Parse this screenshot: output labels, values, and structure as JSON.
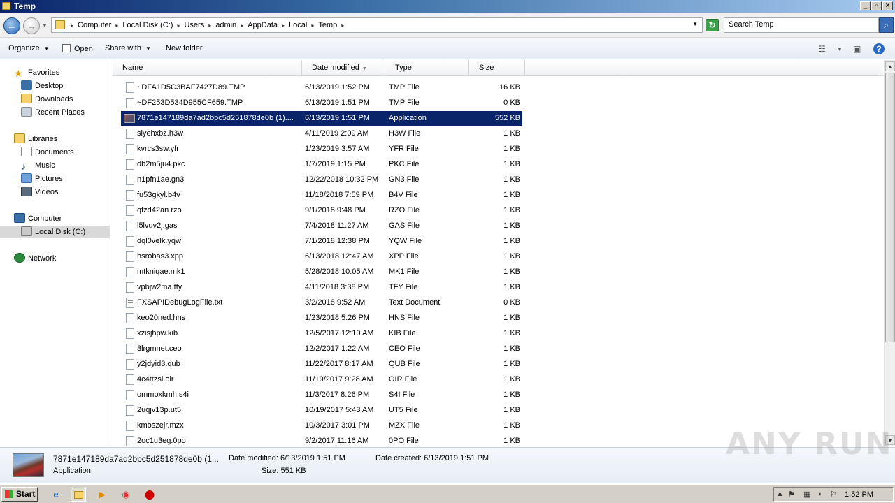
{
  "window": {
    "title": "Temp"
  },
  "address": {
    "crumbs": [
      "Computer",
      "Local Disk (C:)",
      "Users",
      "admin",
      "AppData",
      "Local",
      "Temp"
    ],
    "search_placeholder": "Search Temp"
  },
  "toolbar": {
    "organize": "Organize",
    "open": "Open",
    "share_with": "Share with",
    "new_folder": "New folder"
  },
  "nav": {
    "favorites": "Favorites",
    "desktop": "Desktop",
    "downloads": "Downloads",
    "recent_places": "Recent Places",
    "libraries": "Libraries",
    "documents": "Documents",
    "music": "Music",
    "pictures": "Pictures",
    "videos": "Videos",
    "computer": "Computer",
    "local_disk": "Local Disk (C:)",
    "network": "Network"
  },
  "columns": {
    "name": "Name",
    "date": "Date modified",
    "type": "Type",
    "size": "Size"
  },
  "files": [
    {
      "name": "~DFA1D5C3BAF7427D89.TMP",
      "date": "6/13/2019 1:52 PM",
      "type": "TMP File",
      "size": "16 KB"
    },
    {
      "name": "~DF253D534D955CF659.TMP",
      "date": "6/13/2019 1:51 PM",
      "type": "TMP File",
      "size": "0 KB"
    },
    {
      "name": "7871e147189da7ad2bbc5d251878de0b (1)....",
      "date": "6/13/2019 1:51 PM",
      "type": "Application",
      "size": "552 KB"
    },
    {
      "name": "siyehxbz.h3w",
      "date": "4/11/2019 2:09 AM",
      "type": "H3W File",
      "size": "1 KB"
    },
    {
      "name": "kvrcs3sw.yfr",
      "date": "1/23/2019 3:57 AM",
      "type": "YFR File",
      "size": "1 KB"
    },
    {
      "name": "db2m5ju4.pkc",
      "date": "1/7/2019 1:15 PM",
      "type": "PKC File",
      "size": "1 KB"
    },
    {
      "name": "n1pfn1ae.gn3",
      "date": "12/22/2018 10:32 PM",
      "type": "GN3 File",
      "size": "1 KB"
    },
    {
      "name": "fu53gkyl.b4v",
      "date": "11/18/2018 7:59 PM",
      "type": "B4V File",
      "size": "1 KB"
    },
    {
      "name": "qfzd42an.rzo",
      "date": "9/1/2018 9:48 PM",
      "type": "RZO File",
      "size": "1 KB"
    },
    {
      "name": "l5lvuv2j.gas",
      "date": "7/4/2018 11:27 AM",
      "type": "GAS File",
      "size": "1 KB"
    },
    {
      "name": "dql0velk.yqw",
      "date": "7/1/2018 12:38 PM",
      "type": "YQW File",
      "size": "1 KB"
    },
    {
      "name": "hsrobas3.xpp",
      "date": "6/13/2018 12:47 AM",
      "type": "XPP File",
      "size": "1 KB"
    },
    {
      "name": "mtkniqae.mk1",
      "date": "5/28/2018 10:05 AM",
      "type": "MK1 File",
      "size": "1 KB"
    },
    {
      "name": "vpbjw2ma.tfy",
      "date": "4/11/2018 3:38 PM",
      "type": "TFY File",
      "size": "1 KB"
    },
    {
      "name": "FXSAPIDebugLogFile.txt",
      "date": "3/2/2018 9:52 AM",
      "type": "Text Document",
      "size": "0 KB"
    },
    {
      "name": "keo20ned.hns",
      "date": "1/23/2018 5:26 PM",
      "type": "HNS File",
      "size": "1 KB"
    },
    {
      "name": "xzisjhpw.kib",
      "date": "12/5/2017 12:10 AM",
      "type": "KIB File",
      "size": "1 KB"
    },
    {
      "name": "3lrgmnet.ceo",
      "date": "12/2/2017 1:22 AM",
      "type": "CEO File",
      "size": "1 KB"
    },
    {
      "name": "y2jdyid3.qub",
      "date": "11/22/2017 8:17 AM",
      "type": "QUB File",
      "size": "1 KB"
    },
    {
      "name": "4c4ttzsi.oir",
      "date": "11/19/2017 9:28 AM",
      "type": "OIR File",
      "size": "1 KB"
    },
    {
      "name": "ommoxkmh.s4i",
      "date": "11/3/2017 8:26 PM",
      "type": "S4I File",
      "size": "1 KB"
    },
    {
      "name": "2uqjv13p.ut5",
      "date": "10/19/2017 5:43 AM",
      "type": "UT5 File",
      "size": "1 KB"
    },
    {
      "name": "kmoszejr.mzx",
      "date": "10/3/2017 3:01 PM",
      "type": "MZX File",
      "size": "1 KB"
    },
    {
      "name": "2oc1u3eg.0po",
      "date": "9/2/2017 11:16 AM",
      "type": "0PO File",
      "size": "1 KB"
    }
  ],
  "details": {
    "name": "7871e147189da7ad2bbc5d251878de0b (1...",
    "type": "Application",
    "date_modified": "Date modified:  6/13/2019 1:51 PM",
    "size": "Size:  551 KB",
    "date_created": "Date created:  6/13/2019 1:51 PM"
  },
  "watermark": "ANY RUN",
  "taskbar": {
    "start": "Start",
    "clock": "1:52 PM"
  },
  "colors": {
    "selection": "#0a246a",
    "title_bar": "#0a246a"
  }
}
